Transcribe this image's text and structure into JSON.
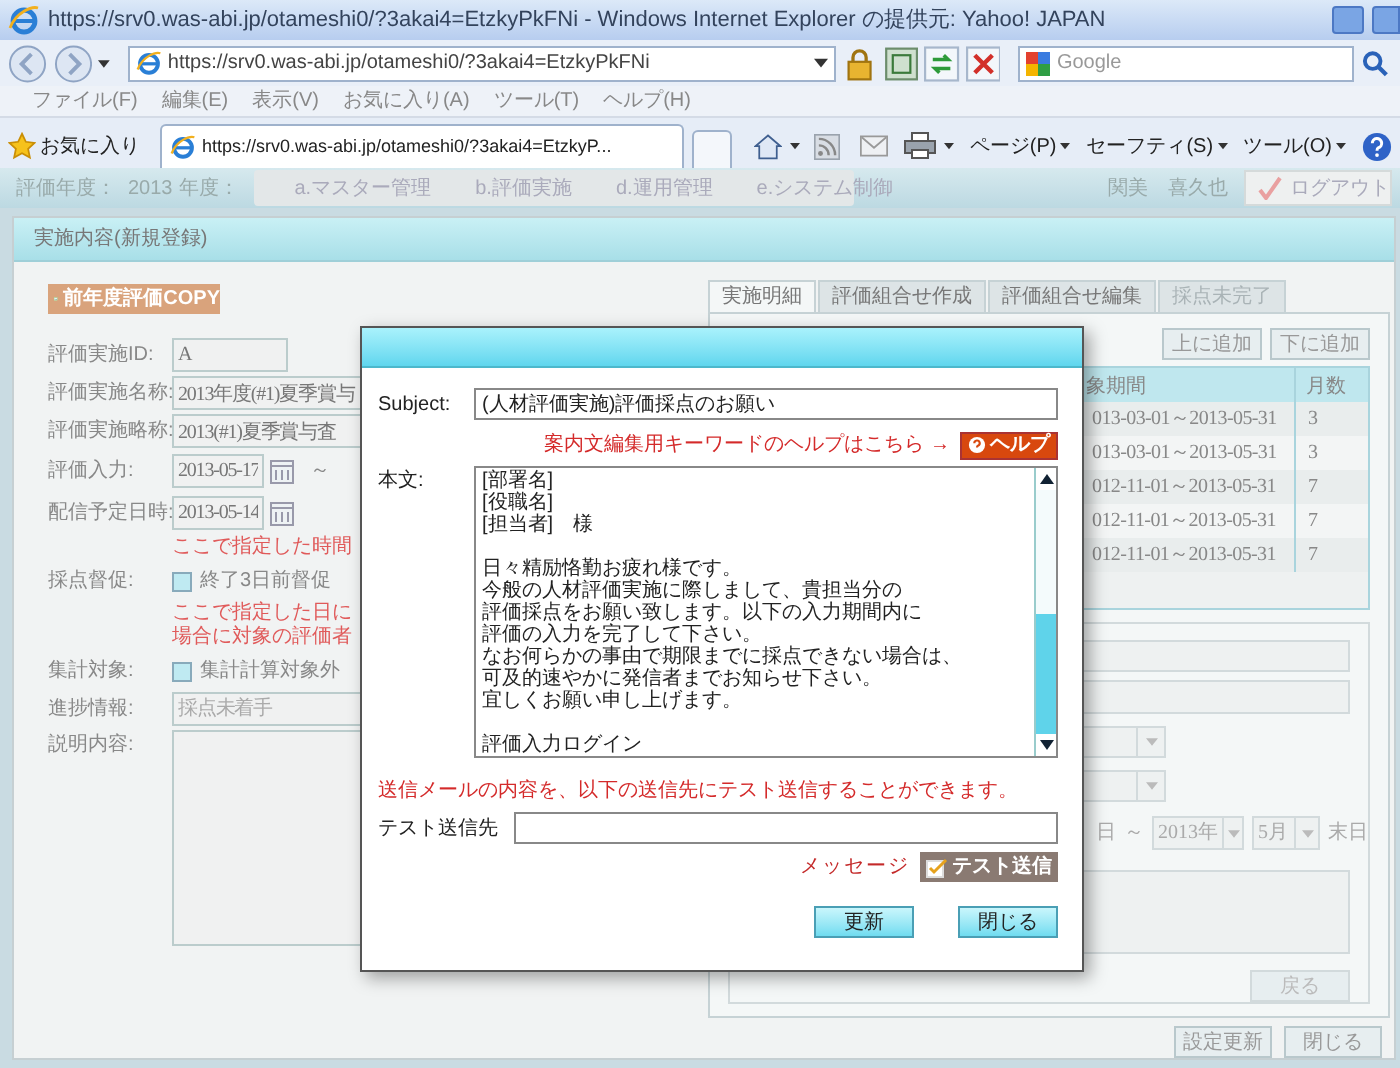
{
  "window": {
    "title": "https://srv0.was-abi.jp/otameshi0/?3akai4=EtzkyPkFNi - Windows Internet Explorer の提供元: Yahoo! JAPAN"
  },
  "address_bar": {
    "url": "https://srv0.was-abi.jp/otameshi0/?3akai4=EtzkyPkFNi"
  },
  "search": {
    "placeholder": "Google"
  },
  "menu": [
    "ファイル(F)",
    "編集(E)",
    "表示(V)",
    "お気に入り(A)",
    "ツール(T)",
    "ヘルプ(H)"
  ],
  "favorites": {
    "label": "お気に入り"
  },
  "tab": {
    "label": "https://srv0.was-abi.jp/otameshi0/?3akai4=EtzkyP..."
  },
  "command_bar": [
    "ページ(P)",
    "セーフティ(S)",
    "ツール(O)"
  ],
  "app_header": {
    "year_label": "評価年度：",
    "year": "2013",
    "year_suffix": "年度：",
    "nav": [
      "a.マスター管理",
      "b.評価実施",
      "d.運用管理",
      "e.システム制御"
    ],
    "user": "関美　喜久也",
    "logout": "ログアウト"
  },
  "panel": {
    "title": "実施内容(新規登録)",
    "copy_button": "前年度評価COPY",
    "form": [
      {
        "kind": "text",
        "label": "評価実施ID:",
        "value": "A"
      },
      {
        "kind": "text",
        "label": "評価実施名称:",
        "value": "2013年度(#1)夏季賞与"
      },
      {
        "kind": "text",
        "label": "評価実施略称:",
        "value": "2013(#1)夏季賞与査"
      },
      {
        "kind": "date",
        "label": "評価入力:",
        "value": "2013-05-17",
        "separator": "～"
      },
      {
        "kind": "date",
        "label": "配信予定日時:",
        "value": "2013-05-14"
      },
      {
        "kind": "note",
        "lines": [
          "ここで指定した時間"
        ]
      },
      {
        "kind": "checkbox",
        "label": "採点督促:",
        "option": "終了3日前督促",
        "checked": false
      },
      {
        "kind": "note",
        "lines": [
          "ここで指定した日に",
          "場合に対象の評価者"
        ]
      },
      {
        "kind": "checkbox",
        "label": "集計対象:",
        "option": "集計計算対象外",
        "checked": false
      },
      {
        "kind": "text",
        "label": "進捗情報:",
        "placeholder": "採点未着手"
      },
      {
        "kind": "textarea",
        "label": "説明内容:"
      }
    ],
    "detail_tabs": [
      {
        "label": "実施明細",
        "selected": true,
        "disabled": false
      },
      {
        "label": "評価組合せ作成",
        "selected": false,
        "disabled": false
      },
      {
        "label": "評価組合せ編集",
        "selected": false,
        "disabled": false
      },
      {
        "label": "採点未完了",
        "selected": false,
        "disabled": true
      }
    ],
    "row_buttons": [
      "上に追加",
      "下に追加"
    ],
    "table": {
      "columns": [
        "象期間",
        "月数"
      ],
      "rows": [
        [
          "013-03-01～2013-05-31",
          "3"
        ],
        [
          "013-03-01～2013-05-31",
          "3"
        ],
        [
          "012-11-01～2013-05-31",
          "7"
        ],
        [
          "012-11-01～2013-05-31",
          "7"
        ],
        [
          "012-11-01～2013-05-31",
          "7"
        ]
      ]
    },
    "period": {
      "day": "日",
      "separator": "～",
      "year": "2013年",
      "month": "5月",
      "end": "末日"
    },
    "back_button": "戻る",
    "footer_buttons": [
      "設定更新",
      "閉じる"
    ]
  },
  "dialog": {
    "subject_label": "Subject:",
    "subject": "(人材評価実施)評価採点のお願い",
    "help_text": "案内文編集用キーワードのヘルプはこちら →",
    "help_button": "ヘルプ",
    "body_label": "本文:",
    "body": [
      [
        "[部署名]",
        "[役職名]",
        "[担当者]　様"
      ],
      [
        "日々精励恪勤お疲れ様です。",
        "今般の人材評価実施に際しまして、貴担当分の",
        "評価採点をお願い致します。以下の入力期間内に",
        "評価の入力を完了して下さい。",
        "なお何らかの事由で期限までに採点できない場合は、",
        "可及的速やかに発信者までお知らせ下さい。",
        "宜しくお願い申し上げます。"
      ],
      [
        "評価入力ログイン"
      ]
    ],
    "test_note": "送信メールの内容を、以下の送信先にテスト送信することができます。",
    "test_label": "テスト送信先",
    "message": "メッセージ",
    "test_button": "テスト送信",
    "buttons": [
      "更新",
      "閉じる"
    ]
  }
}
